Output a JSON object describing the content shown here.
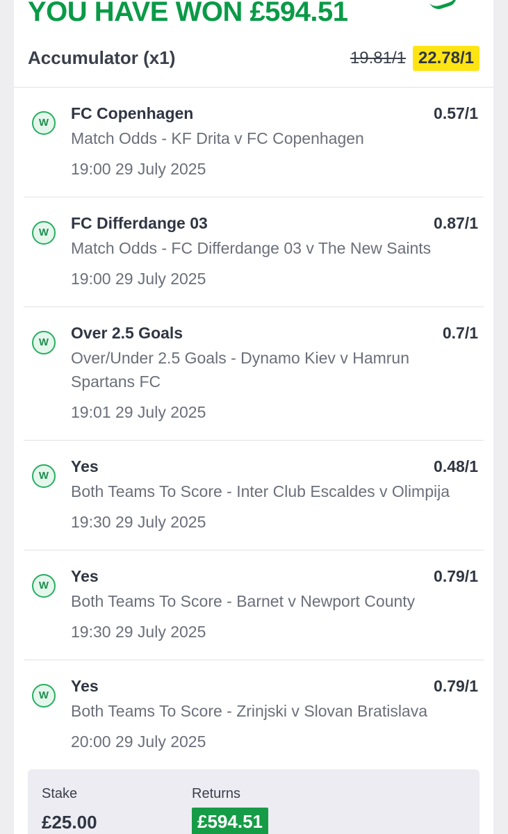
{
  "header": {
    "won_text": "YOU HAVE WON £594.51",
    "bet_type": "Accumulator (x1)",
    "old_odds": "19.81/1",
    "new_odds": "22.78/1"
  },
  "badge_letter": "W",
  "legs": [
    {
      "selection": "FC Copenhagen",
      "odds": "0.57/1",
      "market": "Match Odds - KF Drita v FC Copenhagen",
      "time": "19:00 29 July 2025"
    },
    {
      "selection": "FC Differdange 03",
      "odds": "0.87/1",
      "market": "Match Odds - FC Differdange 03 v The New Saints",
      "time": "19:00 29 July 2025"
    },
    {
      "selection": "Over 2.5 Goals",
      "odds": "0.7/1",
      "market": "Over/Under 2.5 Goals - Dynamo Kiev v Hamrun Spartans FC",
      "time": "19:01 29 July 2025"
    },
    {
      "selection": "Yes",
      "odds": "0.48/1",
      "market": "Both Teams To Score - Inter Club Escaldes v Olimpija",
      "time": "19:30 29 July 2025"
    },
    {
      "selection": "Yes",
      "odds": "0.79/1",
      "market": "Both Teams To Score - Barnet v Newport County",
      "time": "19:30 29 July 2025"
    },
    {
      "selection": "Yes",
      "odds": "0.79/1",
      "market": "Both Teams To Score - Zrinjski v Slovan Bratislava",
      "time": "20:00 29 July 2025"
    }
  ],
  "summary": {
    "stake_label": "Stake",
    "stake_value": "£25.00",
    "returns_label": "Returns",
    "returns_value": "£594.51"
  },
  "colors": {
    "brand_green": "#0a9a47",
    "highlight_yellow": "#ffe414",
    "returns_green": "#169c46"
  }
}
